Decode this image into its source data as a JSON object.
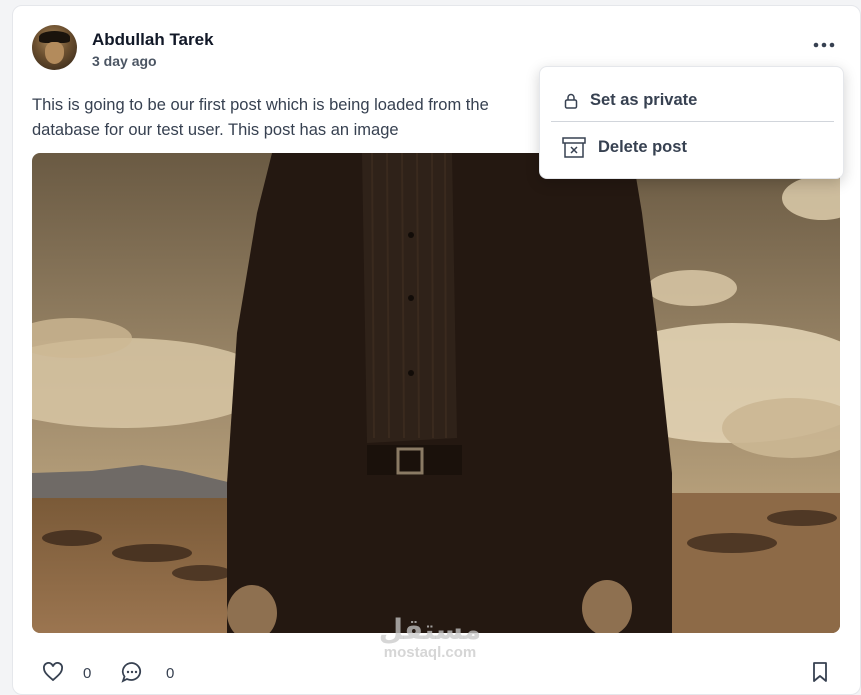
{
  "post": {
    "author": "Abdullah Tarek",
    "time": "3 day ago",
    "text": "This is going to be our first post which is being loaded from the database for our test user. This post has an image",
    "likes": "0",
    "comments": "0"
  },
  "menu": {
    "items": [
      {
        "label": "Set as private",
        "icon": "lock-icon"
      },
      {
        "label": "Delete post",
        "icon": "trash-icon"
      }
    ]
  },
  "watermark": {
    "arabic": "مستقل",
    "latin": "mostaql.com"
  },
  "icons": {
    "more": "more-dots-icon",
    "like": "heart-icon",
    "comment": "comment-icon",
    "save": "bookmark-icon"
  },
  "colors": {
    "text": "#111827",
    "muted": "#4b5563",
    "card": "#ffffff",
    "background": "#f3f4f6"
  }
}
